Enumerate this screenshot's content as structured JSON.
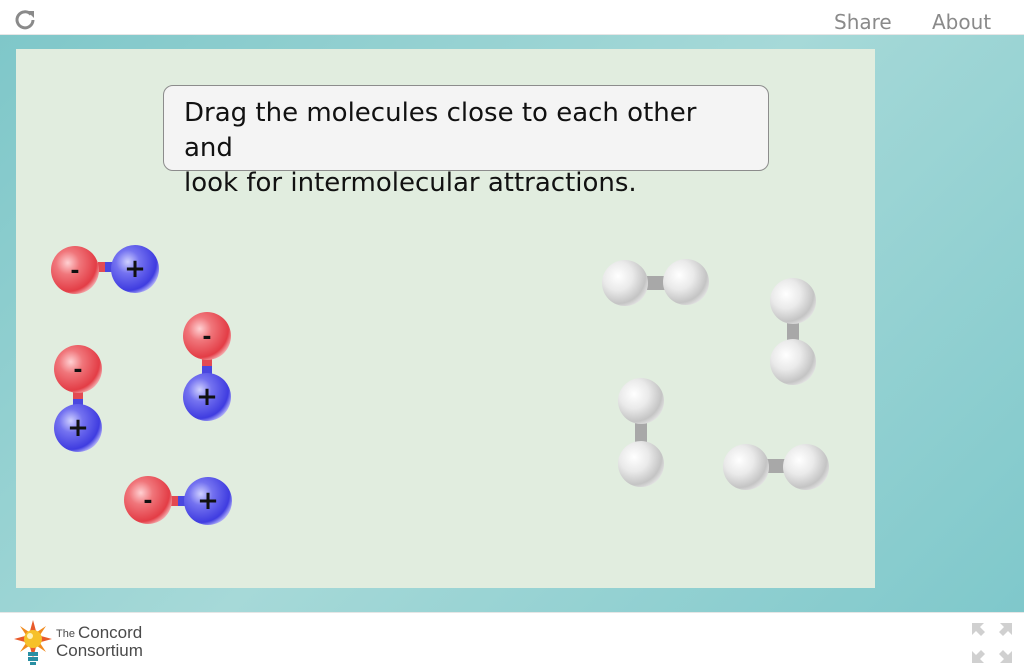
{
  "header": {
    "reload_icon": "reload-icon",
    "share_label": "Share",
    "about_label": "About"
  },
  "simulation": {
    "instructions_line1": "Drag the molecules close to each other and",
    "instructions_line2": "look for intermolecular attractions.",
    "polar_molecule_count": 4,
    "nonpolar_molecule_count": 4,
    "negative_charge": "-",
    "positive_charge": "+",
    "colors": {
      "negative_atom": "#e8545b",
      "positive_atom": "#5653e6",
      "neutral_atom": "#d9d9d9",
      "background": "#e1eddf",
      "frame": "#7fc7c9"
    }
  },
  "footer": {
    "logo_the": "The",
    "logo_name1": "Concord",
    "logo_name2": "Consortium",
    "fullscreen_icon": "fullscreen-icon"
  }
}
